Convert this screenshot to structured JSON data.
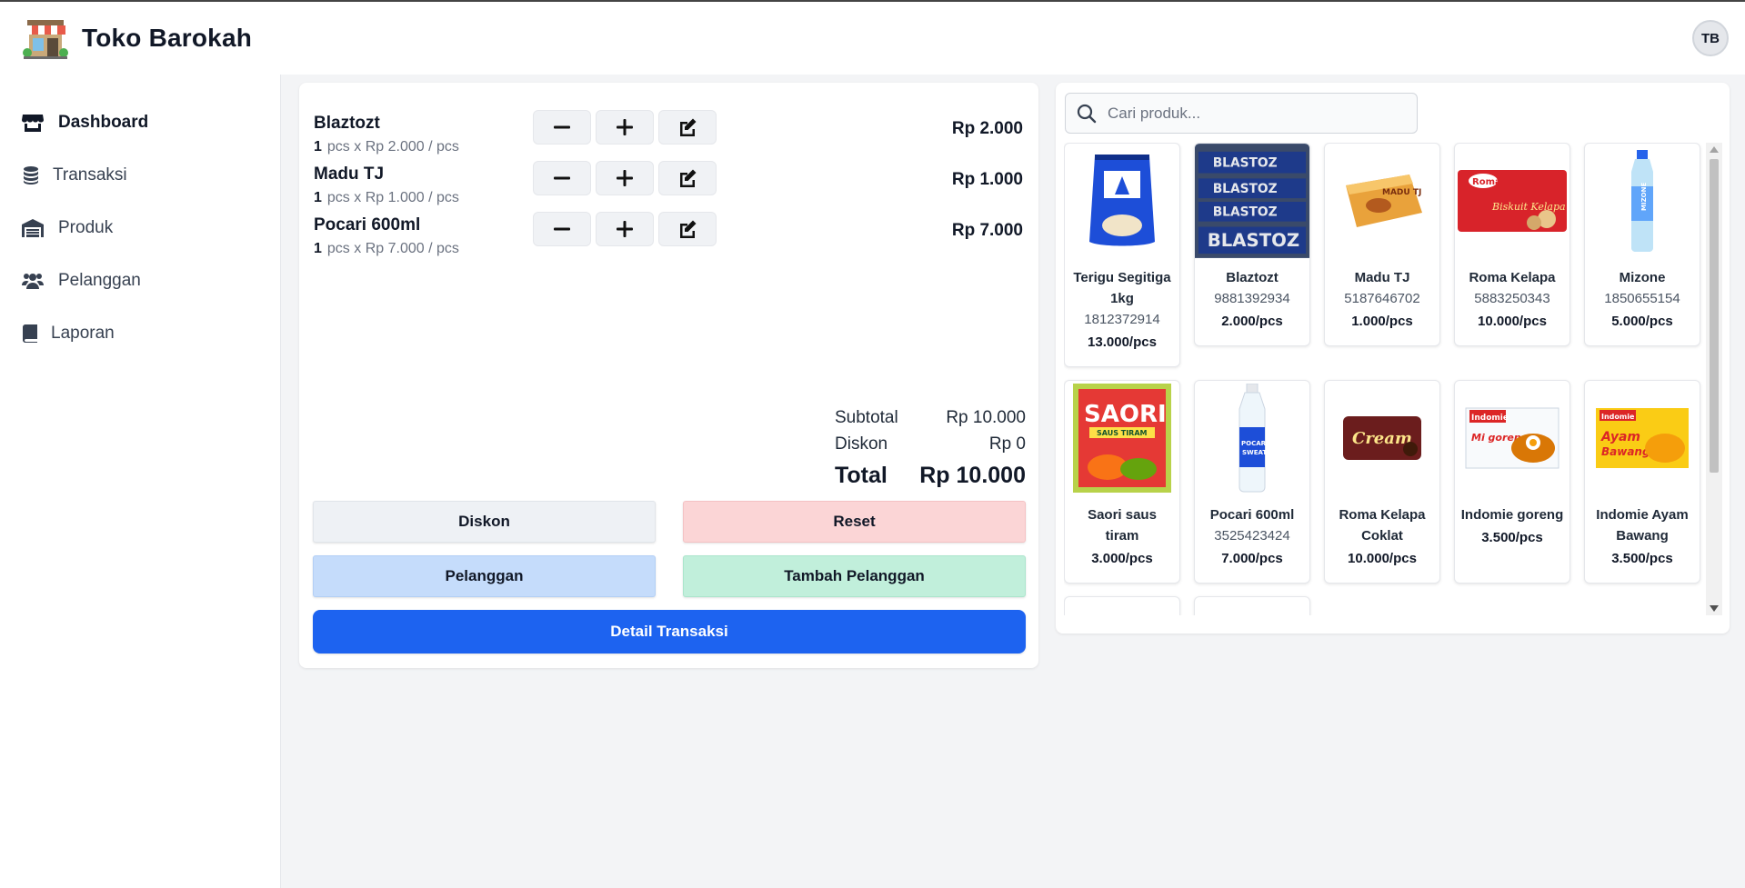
{
  "app": {
    "name": "Toko Barokah",
    "avatar_initials": "TB"
  },
  "sidebar": {
    "items": [
      {
        "label": "Dashboard",
        "icon": "store-icon",
        "active": true
      },
      {
        "label": "Transaksi",
        "icon": "coins-icon",
        "active": false
      },
      {
        "label": "Produk",
        "icon": "warehouse-icon",
        "active": false
      },
      {
        "label": "Pelanggan",
        "icon": "users-icon",
        "active": false
      },
      {
        "label": "Laporan",
        "icon": "book-icon",
        "active": false
      }
    ]
  },
  "cart": {
    "items": [
      {
        "name": "Blaztozt",
        "qty": "1",
        "detail": "pcs x Rp 2.000 / pcs",
        "price": "Rp 2.000"
      },
      {
        "name": "Madu TJ",
        "qty": "1",
        "detail": "pcs x Rp 1.000 / pcs",
        "price": "Rp 1.000"
      },
      {
        "name": "Pocari 600ml",
        "qty": "1",
        "detail": "pcs x Rp 7.000 / pcs",
        "price": "Rp 7.000"
      }
    ],
    "summary": {
      "subtotal_label": "Subtotal",
      "subtotal_value": "Rp 10.000",
      "diskon_label": "Diskon",
      "diskon_value": "Rp 0",
      "total_label": "Total",
      "total_value": "Rp 10.000"
    },
    "buttons": {
      "diskon": "Diskon",
      "reset": "Reset",
      "pelanggan": "Pelanggan",
      "tambah_pelanggan": "Tambah Pelanggan",
      "detail_transaksi": "Detail Transaksi"
    }
  },
  "search": {
    "placeholder": "Cari produk..."
  },
  "products": [
    {
      "name": "Terigu Segitiga 1kg",
      "code": "1812372914",
      "price": "13.000/pcs",
      "image": "flour-bag"
    },
    {
      "name": "Blaztozt",
      "code": "9881392934",
      "price": "2.000/pcs",
      "image": "snack-box"
    },
    {
      "name": "Madu TJ",
      "code": "5187646702",
      "price": "1.000/pcs",
      "image": "honey-box"
    },
    {
      "name": "Roma Kelapa",
      "code": "5883250343",
      "price": "10.000/pcs",
      "image": "biscuit-pack"
    },
    {
      "name": "Mizone",
      "code": "1850655154",
      "price": "5.000/pcs",
      "image": "water-bottle"
    },
    {
      "name": "Saori saus tiram",
      "code": "",
      "price": "3.000/pcs",
      "image": "sauce-sachet"
    },
    {
      "name": "Pocari 600ml",
      "code": "3525423424",
      "price": "7.000/pcs",
      "image": "pocari-bottle"
    },
    {
      "name": "Roma Kelapa Coklat",
      "code": "",
      "price": "10.000/pcs",
      "image": "chocolate-biscuit"
    },
    {
      "name": "Indomie goreng",
      "code": "",
      "price": "3.500/pcs",
      "image": "noodle-pack"
    },
    {
      "name": "Indomie Ayam Bawang",
      "code": "",
      "price": "3.500/pcs",
      "image": "noodle-pack-yellow"
    }
  ],
  "colors": {
    "primary": "#1d63f0",
    "reset_bg": "#fbd5d6",
    "pelanggan_bg": "#c5dcfb",
    "tambah_bg": "#c1efdb",
    "diskon_bg": "#eef1f5"
  }
}
